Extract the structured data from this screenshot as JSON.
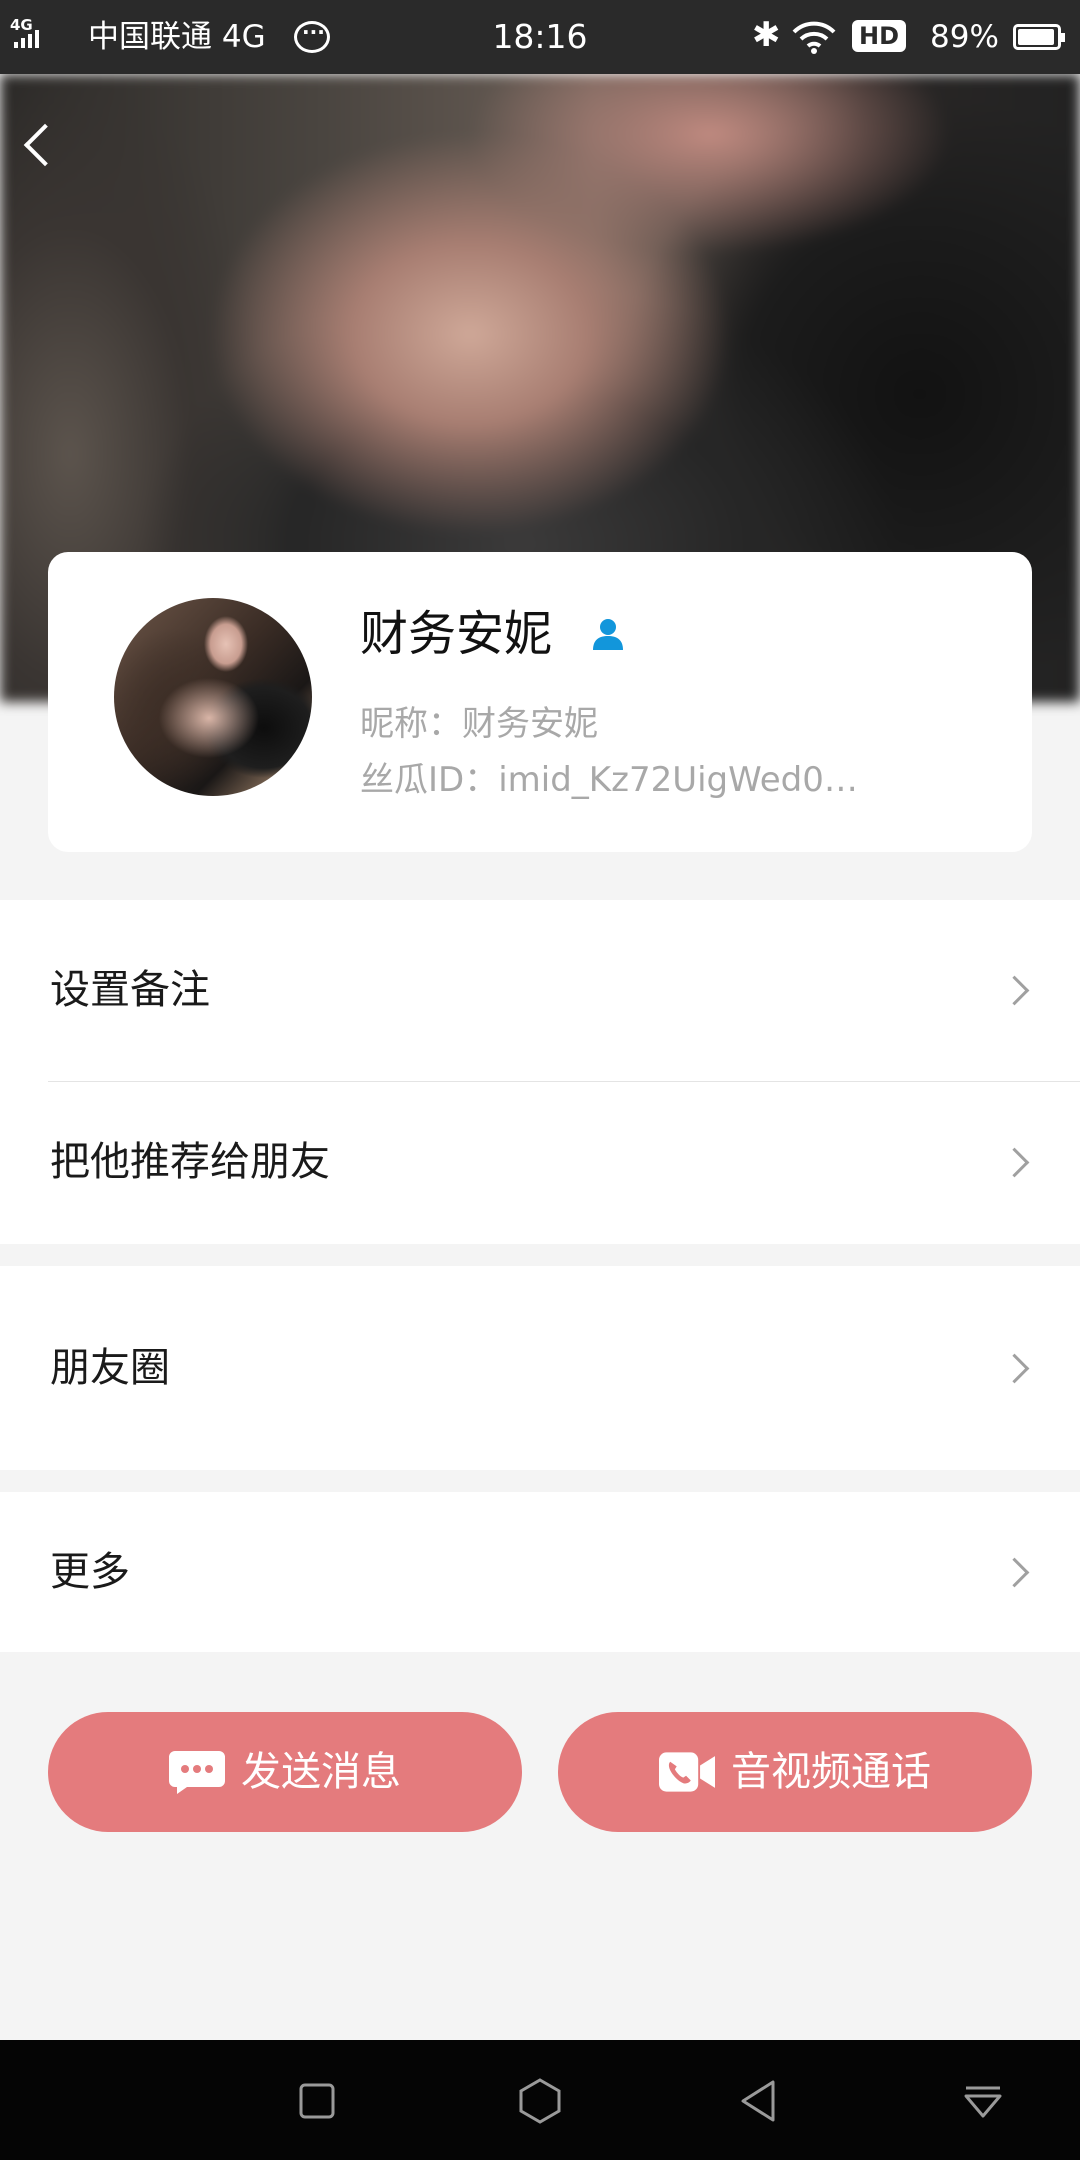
{
  "status_bar": {
    "network_small": "4G",
    "carrier": "中国联通 4G",
    "time": "18:16",
    "hd_badge": "HD",
    "battery": "89%",
    "icons": [
      "signal-icon",
      "chat-bubble-icon",
      "bluetooth-icon",
      "wifi-icon",
      "battery-icon"
    ]
  },
  "header": {
    "back_icon": "back-arrow-icon"
  },
  "profile": {
    "name": "财务安妮",
    "nickname_line": "昵称：财务安妮",
    "id_line": "丝瓜ID：imid_Kz72UigWed0…",
    "verify_icon": "person-icon",
    "accent_color": "#1296db"
  },
  "menu": {
    "remark": "设置备注",
    "recommend": "把他推荐给朋友",
    "moments": "朋友圈",
    "more": "更多"
  },
  "actions": {
    "send_message": "发送消息",
    "av_call": "音视频通话",
    "button_color": "#e47b7d"
  },
  "nav_bar": {
    "items": [
      "square-icon",
      "hexagon-icon",
      "triangle-back-icon",
      "dropdown-icon"
    ]
  }
}
